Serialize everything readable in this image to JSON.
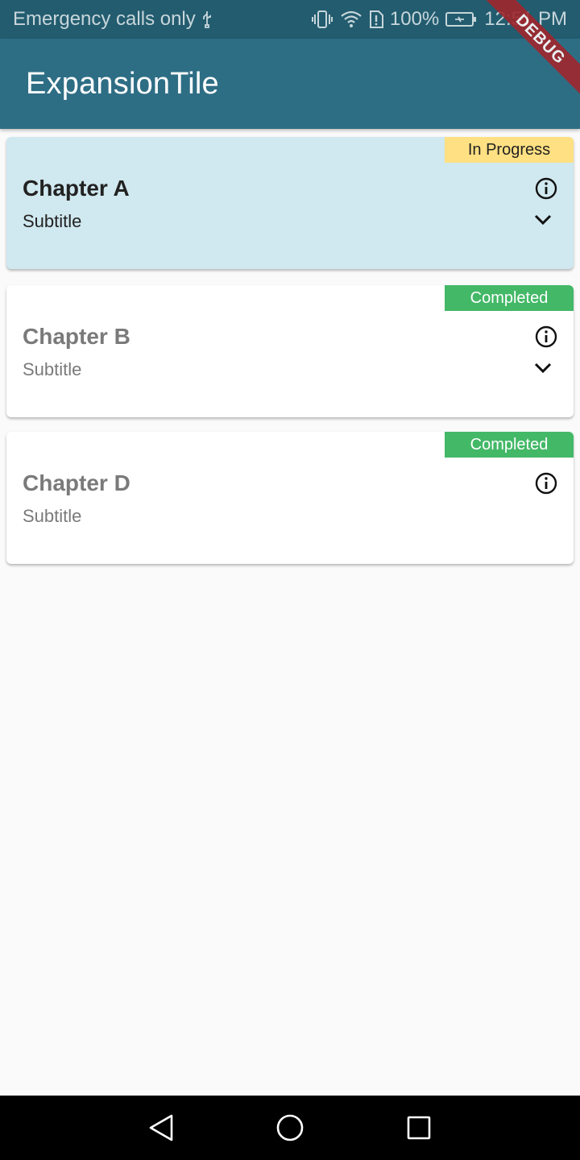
{
  "status_bar": {
    "carrier": "Emergency calls only",
    "battery": "100%",
    "time": "12:51 PM",
    "icons": [
      "usb-icon",
      "vibrate-icon",
      "wifi-icon",
      "sim-alert-icon",
      "battery-charging-icon"
    ]
  },
  "app_bar": {
    "title": "ExpansionTile"
  },
  "debug_banner": {
    "label": "DEBUG"
  },
  "chapters": [
    {
      "title": "Chapter A",
      "subtitle": "Subtitle",
      "status": "In Progress",
      "status_color": "#ffe082",
      "card_color": "#d0e8ef",
      "expandable": true
    },
    {
      "title": "Chapter B",
      "subtitle": "Subtitle",
      "status": "Completed",
      "status_color": "#43b867",
      "card_color": "#ffffff",
      "expandable": true
    },
    {
      "title": "Chapter D",
      "subtitle": "Subtitle",
      "status": "Completed",
      "status_color": "#43b867",
      "card_color": "#ffffff",
      "expandable": false
    }
  ],
  "nav_bar": {
    "buttons": [
      "back-icon",
      "home-icon",
      "recents-icon"
    ]
  },
  "colors": {
    "status_bar": "#235c6f",
    "app_bar": "#2e6e85",
    "background": "#fafafa"
  }
}
